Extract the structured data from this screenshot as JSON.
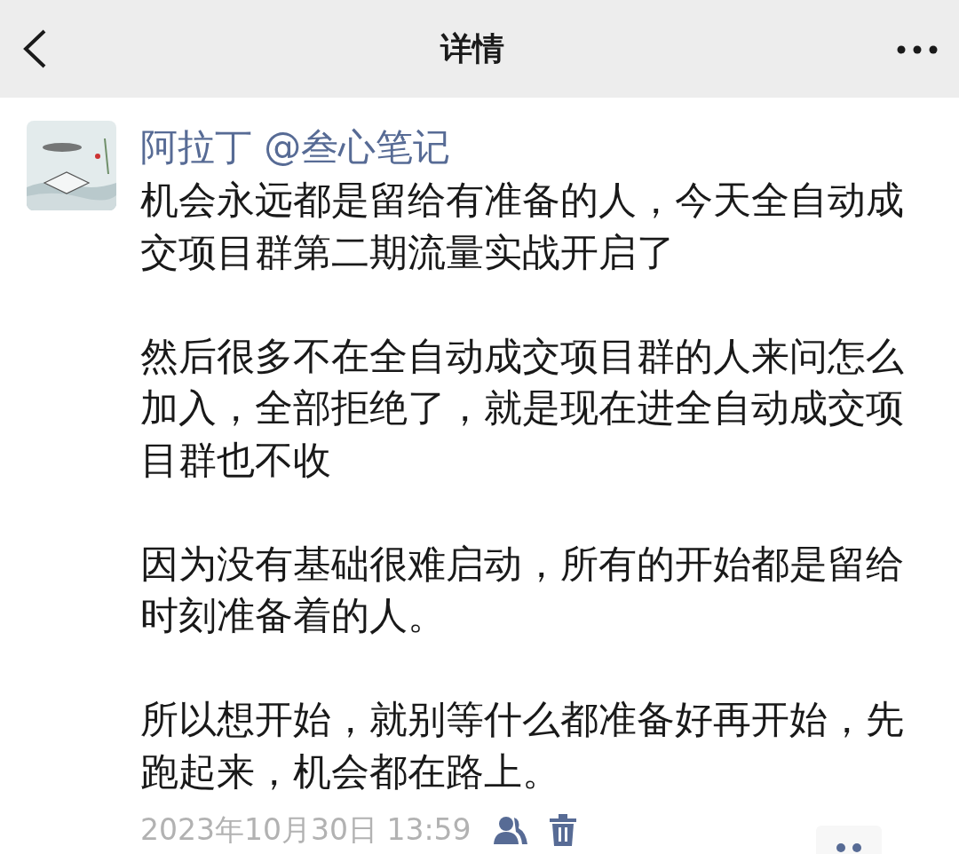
{
  "header": {
    "title": "详情"
  },
  "post": {
    "author": "阿拉丁 @叁心笔记",
    "paragraphs": [
      "机会永远都是留给有准备的人，今天全自动成交项目群第二期流量实战开启了",
      "然后很多不在全自动成交项目群的人来问怎么加入，全部拒绝了，就是现在进全自动成交项目群也不收",
      "因为没有基础很难启动，所有的开始都是留给时刻准备着的人。",
      "所以想开始，就别等什么都准备好再开始，先跑起来，机会都在路上。"
    ],
    "time": "2023年10月30日 13:59"
  }
}
